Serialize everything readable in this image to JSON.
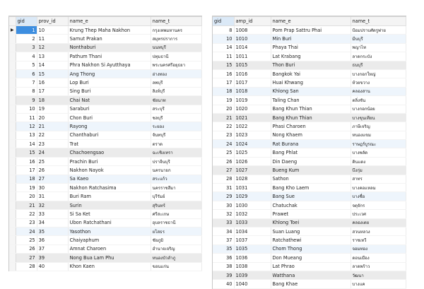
{
  "provinces": {
    "columns": [
      "gid",
      "prov_id",
      "name_e",
      "name_t"
    ],
    "rows": [
      [
        "1",
        "10",
        "Krung Thep Maha Nakhon",
        "กรุงเทพมหานคร"
      ],
      [
        "2",
        "11",
        "Samut Prakan",
        "สมุทรปราการ"
      ],
      [
        "3",
        "12",
        "Nonthaburi",
        "นนทบุรี"
      ],
      [
        "4",
        "13",
        "Pathum Thani",
        "ปทุมธานี"
      ],
      [
        "5",
        "14",
        "Phra Nakhon Si Ayutthaya",
        "พระนครศรีอยุธยา"
      ],
      [
        "6",
        "15",
        "Ang Thong",
        "อ่างทอง"
      ],
      [
        "7",
        "16",
        "Lop Buri",
        "ลพบุรี"
      ],
      [
        "8",
        "17",
        "Sing Buri",
        "สิงห์บุรี"
      ],
      [
        "9",
        "18",
        "Chai Nat",
        "ชัยนาท"
      ],
      [
        "10",
        "19",
        "Saraburi",
        "สระบุรี"
      ],
      [
        "11",
        "20",
        "Chon Buri",
        "ชลบุรี"
      ],
      [
        "12",
        "21",
        "Rayong",
        "ระยอง"
      ],
      [
        "13",
        "22",
        "Chanthaburi",
        "จันทบุรี"
      ],
      [
        "14",
        "23",
        "Trat",
        "ตราด"
      ],
      [
        "15",
        "24",
        "Chachoengsao",
        "ฉะเชิงเทรา"
      ],
      [
        "16",
        "25",
        "Prachin Buri",
        "ปราจีนบุรี"
      ],
      [
        "17",
        "26",
        "Nakhon Nayok",
        "นครนายก"
      ],
      [
        "18",
        "27",
        "Sa Kaeo",
        "สระแก้ว"
      ],
      [
        "19",
        "30",
        "Nakhon Ratchasima",
        "นครราชสีมา"
      ],
      [
        "20",
        "31",
        "Buri Ram",
        "บุรีรัมย์"
      ],
      [
        "21",
        "32",
        "Surin",
        "สุรินทร์"
      ],
      [
        "22",
        "33",
        "Si Sa Ket",
        "ศรีสะเกษ"
      ],
      [
        "23",
        "34",
        "Ubon Ratchathani",
        "อุบลราชธานี"
      ],
      [
        "24",
        "35",
        "Yasothon",
        "ยโสธร"
      ],
      [
        "25",
        "36",
        "Chaiyaphum",
        "ชัยภูมิ"
      ],
      [
        "26",
        "37",
        "Amnat Charoen",
        "อำนาจเจริญ"
      ],
      [
        "27",
        "39",
        "Nong Bua Lam Phu",
        "หนองบัวลำภู"
      ],
      [
        "28",
        "40",
        "Khon Kaen",
        "ขอนแก่น"
      ]
    ]
  },
  "districts": {
    "columns": [
      "gid",
      "amp_id",
      "name_e",
      "name_t"
    ],
    "rows": [
      [
        "8",
        "1008",
        "Pom Prap Sattru Phai",
        "ป้อมปราบศัตรูพ่าย"
      ],
      [
        "10",
        "1010",
        "Min Buri",
        "มีนบุรี"
      ],
      [
        "14",
        "1014",
        "Phaya Thai",
        "พญาไท"
      ],
      [
        "11",
        "1011",
        "Lat Krabang",
        "ลาดกระบัง"
      ],
      [
        "15",
        "1015",
        "Thon Buri",
        "ธนบุรี"
      ],
      [
        "16",
        "1016",
        "Bangkok Yai",
        "บางกอกใหญ่"
      ],
      [
        "17",
        "1017",
        "Huai Khwang",
        "ห้วยขวาง"
      ],
      [
        "18",
        "1018",
        "Khlong San",
        "คลองสาน"
      ],
      [
        "19",
        "1019",
        "Taling Chan",
        "ตลิ่งชัน"
      ],
      [
        "20",
        "1020",
        "Bang Khun Thian",
        "บางกอกน้อย"
      ],
      [
        "21",
        "1021",
        "Bang Khun Thian",
        "บางขุนเทียน"
      ],
      [
        "22",
        "1022",
        "Phasi Charoen",
        "ภาษีเจริญ"
      ],
      [
        "23",
        "1023",
        "Nong Khaem",
        "หนองแขม"
      ],
      [
        "24",
        "1024",
        "Rat Burana",
        "ราษฎร์บูรณะ"
      ],
      [
        "25",
        "1025",
        "Bang Phlat",
        "บางพลัด"
      ],
      [
        "26",
        "1026",
        "Din Daeng",
        "ดินแดง"
      ],
      [
        "27",
        "1027",
        "Bueng Kum",
        "บึงกุ่ม"
      ],
      [
        "28",
        "1028",
        "Sathon",
        "สาทร"
      ],
      [
        "31",
        "1031",
        "Bang Kho Laem",
        "บางคอแหลม"
      ],
      [
        "29",
        "1029",
        "Bang Sue",
        "บางซื่อ"
      ],
      [
        "30",
        "1030",
        "Chatuchak",
        "จตุจักร"
      ],
      [
        "32",
        "1032",
        "Prawet",
        "ประเวศ"
      ],
      [
        "33",
        "1033",
        "Khlong Toei",
        "คลองเตย"
      ],
      [
        "34",
        "1034",
        "Suan Luang",
        "สวนหลวง"
      ],
      [
        "37",
        "1037",
        "Ratchathewi",
        "ราชเทวี"
      ],
      [
        "35",
        "1035",
        "Chom Thong",
        "จอมทอง"
      ],
      [
        "36",
        "1036",
        "Don Mueang",
        "ดอนเมือง"
      ],
      [
        "38",
        "1038",
        "Lat Phrao",
        "ลาดพร้าว"
      ],
      [
        "39",
        "1039",
        "Watthana",
        "วัฒนา"
      ],
      [
        "40",
        "1040",
        "Bang Khae",
        "บางแค"
      ]
    ]
  }
}
